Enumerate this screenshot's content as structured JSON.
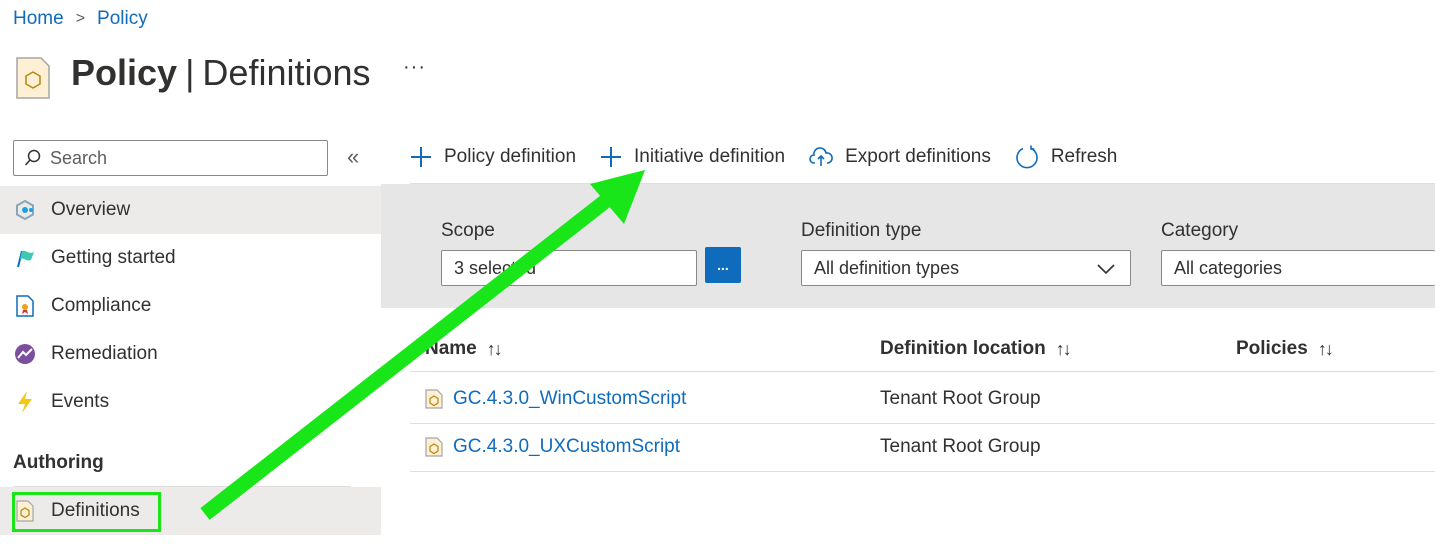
{
  "breadcrumb": {
    "home": "Home",
    "policy": "Policy"
  },
  "page": {
    "title_bold": "Policy",
    "title_sep": "|",
    "title_rest": "Definitions",
    "more": "···"
  },
  "sidebar": {
    "search_placeholder": "Search",
    "collapse": "«",
    "items": [
      {
        "label": "Overview",
        "icon": "overview-icon"
      },
      {
        "label": "Getting started",
        "icon": "getting-started-icon"
      },
      {
        "label": "Compliance",
        "icon": "compliance-icon"
      },
      {
        "label": "Remediation",
        "icon": "remediation-icon"
      },
      {
        "label": "Events",
        "icon": "events-icon"
      }
    ],
    "section": "Authoring",
    "authoring_items": [
      {
        "label": "Definitions",
        "icon": "definition-icon"
      }
    ]
  },
  "toolbar": {
    "policy_definition": "Policy definition",
    "initiative_definition": "Initiative definition",
    "export_definitions": "Export definitions",
    "refresh": "Refresh"
  },
  "filters": {
    "scope_label": "Scope",
    "scope_value": "3 selected",
    "scope_button": "...",
    "type_label": "Definition type",
    "type_value": "All definition types",
    "category_label": "Category",
    "category_value": "All categories"
  },
  "table": {
    "columns": [
      "Name",
      "Definition location",
      "Policies"
    ],
    "sort_glyph": "↑↓",
    "rows": [
      {
        "name": "GC.4.3.0_WinCustomScript",
        "location": "Tenant Root Group"
      },
      {
        "name": "GC.4.3.0_UXCustomScript",
        "location": "Tenant Root Group"
      }
    ]
  },
  "colors": {
    "accent": "#0f6cbd",
    "annotation": "#19e619",
    "filter_bg": "#e6e6e6",
    "selected_bg": "#edebe9"
  }
}
